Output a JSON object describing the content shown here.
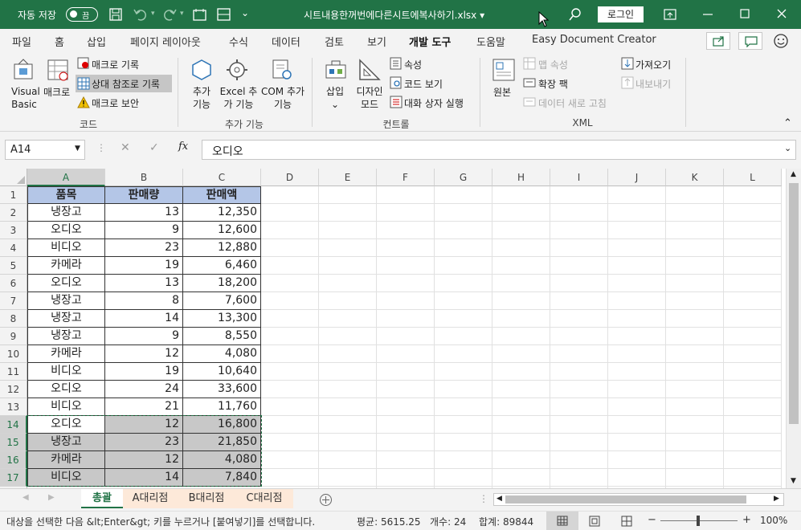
{
  "titlebar": {
    "autosave_label": "자동 저장",
    "autosave_state": "끔",
    "filename": "시트내용한꺼번에다른시트에복사하기.xlsx",
    "login_label": "로그인"
  },
  "tabs": [
    "파일",
    "홈",
    "삽입",
    "페이지 레이아웃",
    "수식",
    "데이터",
    "검토",
    "보기",
    "개발 도구",
    "도움말",
    "Easy Document Creator"
  ],
  "active_tab": "개발 도구",
  "ribbon": {
    "code": {
      "visual_basic": "Visual Basic",
      "macro": "매크로",
      "record_macro": "매크로 기록",
      "relative_ref": "상대 참조로 기록",
      "macro_security": "매크로 보안",
      "group_label": "코드"
    },
    "addins": {
      "addins": "추가 기능",
      "excel_addins": "Excel 추가 기능",
      "com_addins": "COM 추가 기능",
      "group_label": "추가 기능"
    },
    "controls": {
      "insert": "삽입",
      "design_mode": "디자인 모드",
      "properties": "속성",
      "view_code": "코드 보기",
      "run_dialog": "대화 상자 실행",
      "group_label": "컨트롤"
    },
    "xml": {
      "source": "원본",
      "map_properties": "맵 속성",
      "expansion_packs": "확장 팩",
      "refresh_data": "데이터 새로 고침",
      "import": "가져오기",
      "export": "내보내기",
      "group_label": "XML"
    }
  },
  "formula_bar": {
    "name_box": "A14",
    "fx": "fx",
    "formula": "오디오"
  },
  "columns": [
    "A",
    "B",
    "C",
    "D",
    "E",
    "F",
    "G",
    "H",
    "I",
    "J",
    "K",
    "L"
  ],
  "table": {
    "headers": [
      "품목",
      "판매량",
      "판매액"
    ],
    "rows": [
      [
        "냉장고",
        "13",
        "12,350"
      ],
      [
        "오디오",
        "9",
        "12,600"
      ],
      [
        "비디오",
        "23",
        "12,880"
      ],
      [
        "카메라",
        "19",
        "6,460"
      ],
      [
        "오디오",
        "13",
        "18,200"
      ],
      [
        "냉장고",
        "8",
        "7,600"
      ],
      [
        "냉장고",
        "14",
        "13,300"
      ],
      [
        "냉장고",
        "9",
        "8,550"
      ],
      [
        "카메라",
        "12",
        "4,080"
      ],
      [
        "비디오",
        "19",
        "10,640"
      ],
      [
        "오디오",
        "24",
        "33,600"
      ],
      [
        "비디오",
        "21",
        "11,760"
      ],
      [
        "오디오",
        "12",
        "16,800"
      ],
      [
        "냉장고",
        "23",
        "21,850"
      ],
      [
        "카메라",
        "12",
        "4,080"
      ],
      [
        "비디오",
        "14",
        "7,840"
      ]
    ]
  },
  "row_numbers": [
    "1",
    "2",
    "3",
    "4",
    "5",
    "6",
    "7",
    "8",
    "9",
    "10",
    "11",
    "12",
    "13",
    "14",
    "15",
    "16",
    "17"
  ],
  "sheets": [
    "총괄",
    "A대리점",
    "B대리점",
    "C대리점"
  ],
  "status": {
    "message": "대상을 선택한 다음 &lt;Enter&gt; 키를 누르거나 [붙여넣기]를 선택합니다.",
    "average": "평균: 5615.25",
    "count": "개수: 24",
    "sum": "합계: 89844",
    "zoom": "100%"
  },
  "colors": {
    "excel_green": "#217346",
    "header_fill": "#b4c6e7",
    "selection_fill": "#c8c8c8"
  }
}
